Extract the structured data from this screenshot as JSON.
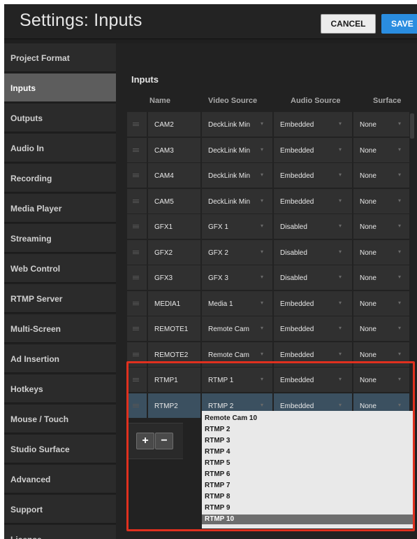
{
  "header": {
    "title": "Settings: Inputs",
    "cancel_label": "CANCEL",
    "save_label": "SAVE"
  },
  "sidebar": {
    "items": [
      {
        "label": "Project Format",
        "active": false
      },
      {
        "label": "Inputs",
        "active": true
      },
      {
        "label": "Outputs",
        "active": false
      },
      {
        "label": "Audio In",
        "active": false
      },
      {
        "label": "Recording",
        "active": false
      },
      {
        "label": "Media Player",
        "active": false
      },
      {
        "label": "Streaming",
        "active": false
      },
      {
        "label": "Web Control",
        "active": false
      },
      {
        "label": "RTMP Server",
        "active": false
      },
      {
        "label": "Multi-Screen",
        "active": false
      },
      {
        "label": "Ad Insertion",
        "active": false
      },
      {
        "label": "Hotkeys",
        "active": false
      },
      {
        "label": "Mouse / Touch",
        "active": false
      },
      {
        "label": "Studio Surface",
        "active": false
      },
      {
        "label": "Advanced",
        "active": false
      },
      {
        "label": "Support",
        "active": false
      },
      {
        "label": "License",
        "active": false
      }
    ]
  },
  "inputs": {
    "title": "Inputs",
    "columns": [
      "Name",
      "Video Source",
      "Audio Source",
      "Surface"
    ],
    "rows": [
      {
        "name": "CAM2",
        "video": "DeckLink Min",
        "audio": "Embedded",
        "surface": "None"
      },
      {
        "name": "CAM3",
        "video": "DeckLink Min",
        "audio": "Embedded",
        "surface": "None"
      },
      {
        "name": "CAM4",
        "video": "DeckLink Min",
        "audio": "Embedded",
        "surface": "None"
      },
      {
        "name": "CAM5",
        "video": "DeckLink Min",
        "audio": "Embedded",
        "surface": "None"
      },
      {
        "name": "GFX1",
        "video": "GFX 1",
        "audio": "Disabled",
        "surface": "None"
      },
      {
        "name": "GFX2",
        "video": "GFX 2",
        "audio": "Disabled",
        "surface": "None"
      },
      {
        "name": "GFX3",
        "video": "GFX 3",
        "audio": "Disabled",
        "surface": "None"
      },
      {
        "name": "MEDIA1",
        "video": "Media 1",
        "audio": "Embedded",
        "surface": "None"
      },
      {
        "name": "REMOTE1",
        "video": "Remote Cam",
        "audio": "Embedded",
        "surface": "None"
      },
      {
        "name": "REMOTE2",
        "video": "Remote Cam",
        "audio": "Embedded",
        "surface": "None"
      },
      {
        "name": "RTMP1",
        "video": "RTMP 1",
        "audio": "Embedded",
        "surface": "None"
      },
      {
        "name": "RTMP2",
        "video": "RTMP 2",
        "audio": "Embedded",
        "surface": "None"
      }
    ],
    "selected_row": 11,
    "add_label": "+",
    "remove_label": "−"
  },
  "dropdown": {
    "options": [
      "Remote Cam 10",
      "RTMP 2",
      "RTMP 3",
      "RTMP 4",
      "RTMP 5",
      "RTMP 6",
      "RTMP 7",
      "RTMP 8",
      "RTMP 9",
      "RTMP 10"
    ],
    "highlighted_index": 9
  },
  "icons": {
    "drag": "drag-handle-icon",
    "chevron": "chevron-down-icon"
  },
  "colors": {
    "save_button": "#2a8de0",
    "selected_row": "#3b5060",
    "highlight_box": "#e0301e",
    "active_sidebar": "#5d5d5d"
  }
}
